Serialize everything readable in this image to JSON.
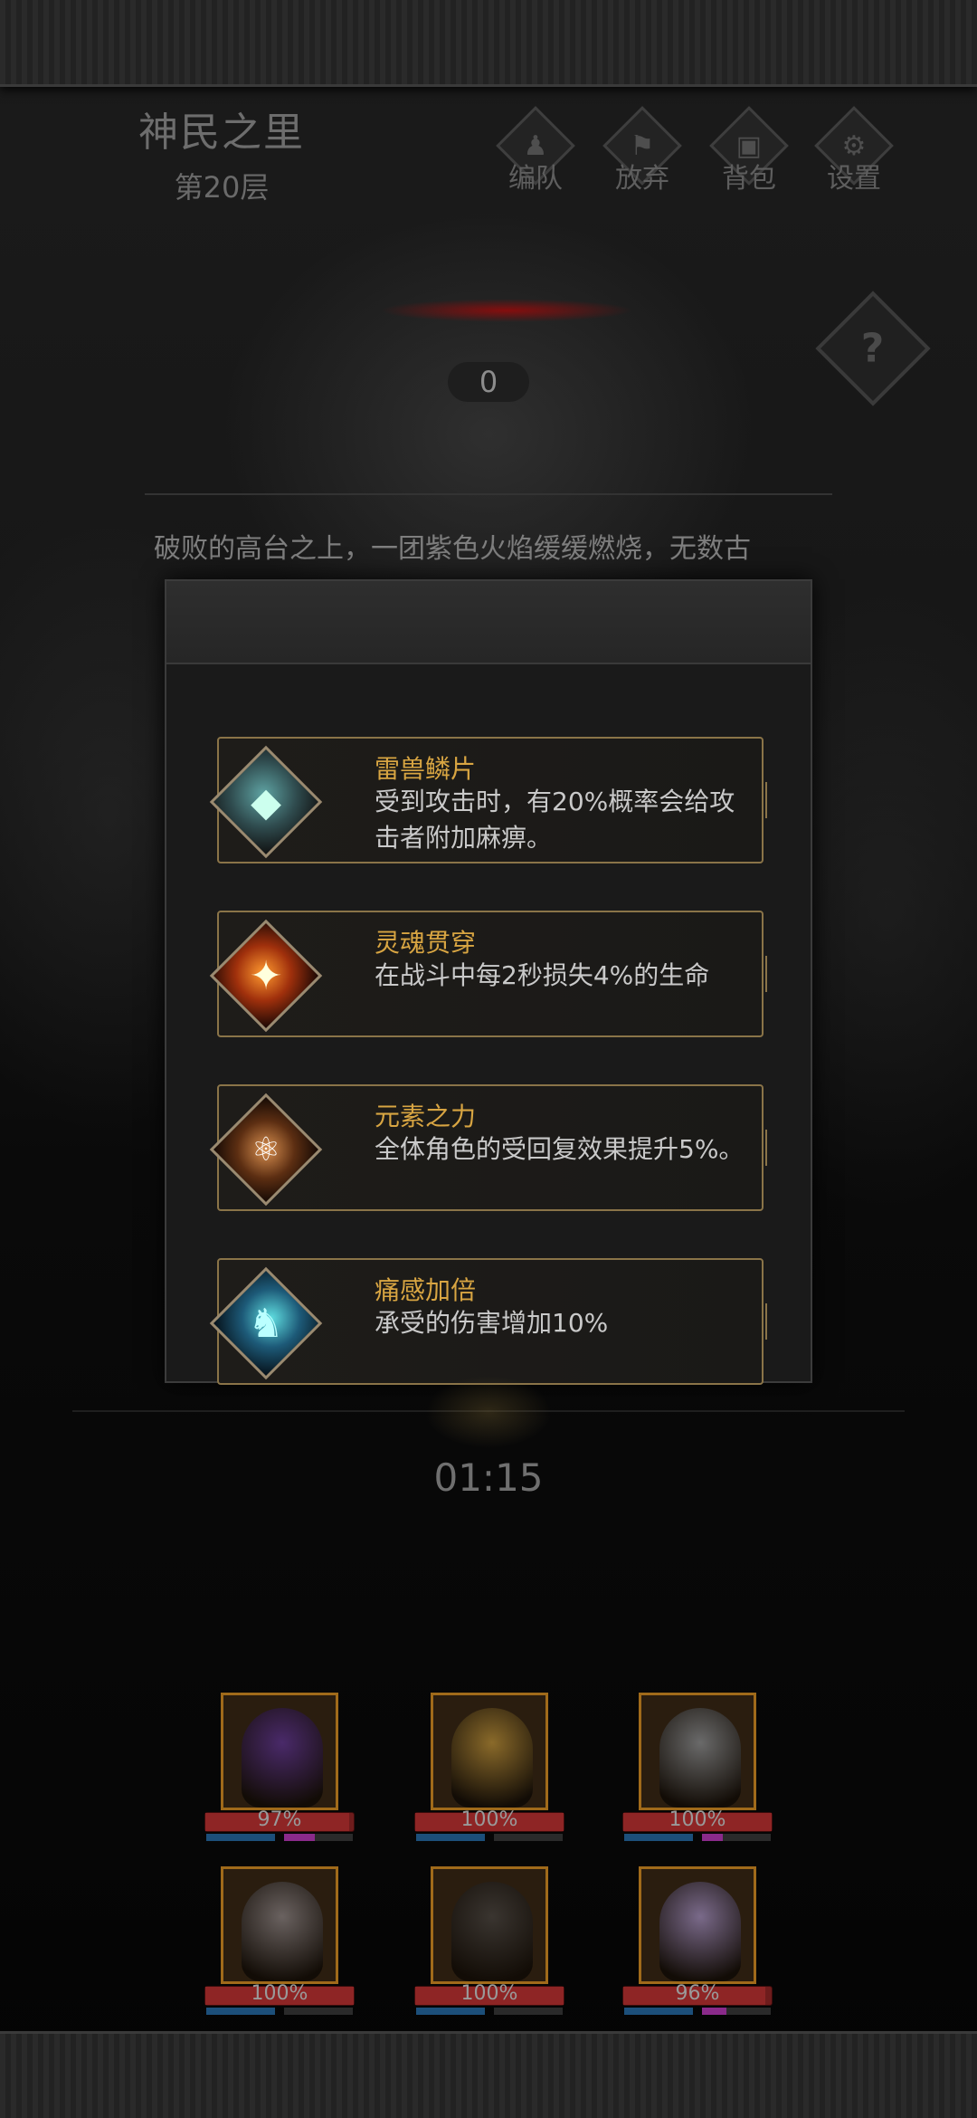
{
  "header": {
    "floor_title": "神民之里",
    "floor_sub": "第20层",
    "buttons": [
      {
        "label": "编队",
        "icon": "team-icon"
      },
      {
        "label": "放弃",
        "icon": "abandon-icon"
      },
      {
        "label": "背包",
        "icon": "bag-icon"
      },
      {
        "label": "设置",
        "icon": "settings-icon"
      }
    ]
  },
  "score": "0",
  "story_text": "破败的高台之上，一团紫色火焰缓缓燃烧，无数古",
  "buffs": [
    {
      "name": "雷兽鳞片",
      "desc": "受到攻击时，有20%概率会给攻击者附加麻痹。",
      "icon": "scale-icon"
    },
    {
      "name": "灵魂贯穿",
      "desc": "在战斗中每2秒损失4%的生命",
      "icon": "soul-pierce-icon"
    },
    {
      "name": "元素之力",
      "desc": "全体角色的受回复效果提升5%。",
      "icon": "element-icon"
    },
    {
      "name": "痛感加倍",
      "desc": "承受的伤害增加10%",
      "icon": "pain-icon"
    }
  ],
  "timer": "01:15",
  "heroes": [
    {
      "hp_label": "97%",
      "hp": 0.97,
      "rage": 0.45,
      "color": "#4a2a6a"
    },
    {
      "hp_label": "100%",
      "hp": 1.0,
      "rage": 0.0,
      "color": "#8a6a2a"
    },
    {
      "hp_label": "100%",
      "hp": 1.0,
      "rage": 0.3,
      "color": "#6a6a6a"
    },
    {
      "hp_label": "100%",
      "hp": 1.0,
      "rage": 0.0,
      "color": "#6a6260"
    },
    {
      "hp_label": "100%",
      "hp": 1.0,
      "rage": 0.0,
      "color": "#3a3530"
    },
    {
      "hp_label": "96%",
      "hp": 0.96,
      "rage": 0.35,
      "color": "#7a6a8a"
    }
  ],
  "colors": {
    "accent_gold": "#d8a542",
    "frame_gold": "#8a7448",
    "hp_red": "#8e2525"
  }
}
